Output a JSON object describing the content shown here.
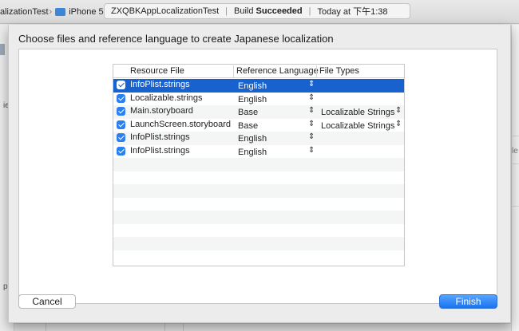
{
  "toolbar": {
    "scheme_name": "alizationTest",
    "device": "iPhone 5",
    "activity": {
      "project": "ZXQBKAppLocalizationTest",
      "build_prefix": "Build",
      "build_status": "Succeeded",
      "time": "Today at 下午1:38"
    }
  },
  "dialog": {
    "title": "Choose files and reference language to create Japanese localization",
    "columns": {
      "resource_file": "Resource File",
      "reference_language": "Reference Language",
      "file_types": "File Types"
    },
    "rows": [
      {
        "file": "InfoPlist.strings",
        "reference": "English",
        "file_type": ""
      },
      {
        "file": "Localizable.strings",
        "reference": "English",
        "file_type": ""
      },
      {
        "file": "Main.storyboard",
        "reference": "Base",
        "file_type": "Localizable Strings"
      },
      {
        "file": "LaunchScreen.storyboard",
        "reference": "Base",
        "file_type": "Localizable Strings"
      },
      {
        "file": "InfoPlist.strings",
        "reference": "English",
        "file_type": ""
      },
      {
        "file": "InfoPlist.strings",
        "reference": "English",
        "file_type": ""
      }
    ],
    "cancel_label": "Cancel",
    "finish_label": "Finish"
  },
  "background": {
    "left_glyph_1": "ie",
    "left_glyph_2": "p",
    "right_glyph": "le"
  },
  "colors": {
    "accent": "#1862d0",
    "checkbox": "#2a7ff1",
    "finish_button": "#1b74ee"
  }
}
